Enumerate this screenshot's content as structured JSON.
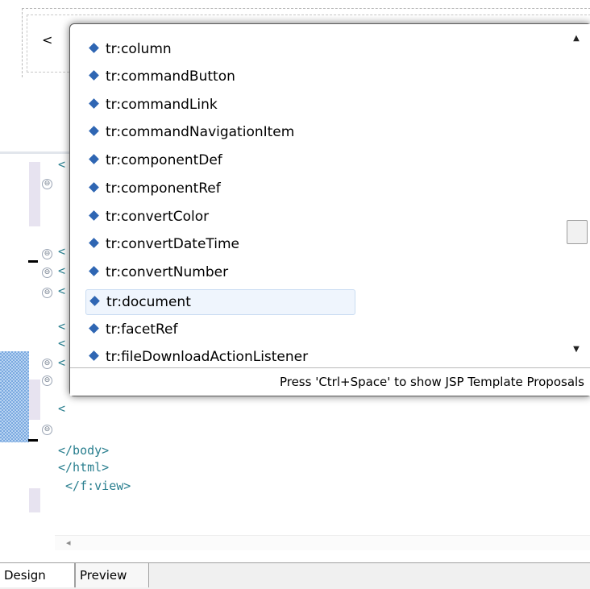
{
  "design": {
    "open_bracket": "<"
  },
  "content_assist": {
    "proposals": [
      {
        "label": "tr:column"
      },
      {
        "label": "tr:commandButton"
      },
      {
        "label": "tr:commandLink"
      },
      {
        "label": "tr:commandNavigationItem"
      },
      {
        "label": "tr:componentDef"
      },
      {
        "label": "tr:componentRef"
      },
      {
        "label": "tr:convertColor"
      },
      {
        "label": "tr:convertDateTime"
      },
      {
        "label": "tr:convertNumber"
      },
      {
        "label": "tr:document",
        "selected": true
      },
      {
        "label": "tr:facetRef"
      },
      {
        "label": "tr:fileDownloadActionListener"
      }
    ],
    "status_text": "Press 'Ctrl+Space' to show JSP Template Proposals",
    "scrollbar": {
      "up_icon": "triangle-up-icon",
      "down_icon": "triangle-down-icon"
    }
  },
  "source": {
    "glyphs": [
      "<",
      "<",
      "<",
      "<",
      "<",
      "<",
      "<",
      "<"
    ],
    "lines": [
      "</body>",
      "</html>",
      " </f:view>"
    ],
    "fold_symbol": "⊖",
    "hscroll_left": "◂"
  },
  "tabs": {
    "design": "Design",
    "preview": "Preview"
  },
  "colors": {
    "selection_bg": "#eff5fd",
    "icon_blue": "#2f66b3",
    "code_teal": "#2a7f8f"
  }
}
